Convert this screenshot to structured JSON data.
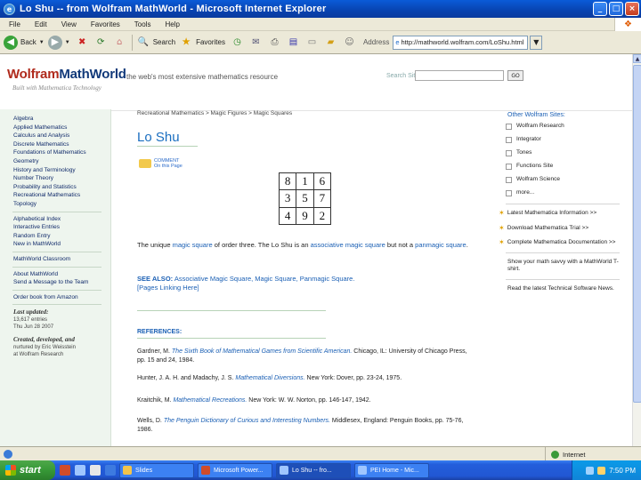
{
  "window": {
    "title": "Lo Shu -- from Wolfram MathWorld - Microsoft Internet Explorer"
  },
  "menu": [
    "File",
    "Edit",
    "View",
    "Favorites",
    "Tools",
    "Help"
  ],
  "toolbar": {
    "back": "Back",
    "search": "Search",
    "favorites": "Favorites",
    "address_label": "Address",
    "address": "http://mathworld.wolfram.com/LoShu.html"
  },
  "header": {
    "logo_wolfram": "Wolfram",
    "logo_mathworld": "MathWorld",
    "tagline": "the web's most extensive mathematics resource",
    "built_with": "Built with Mathematica Technology",
    "search_label": "Search Site",
    "search_go": "GO"
  },
  "left_sidebar": {
    "topics": [
      "Algebra",
      "Applied Mathematics",
      "Calculus and Analysis",
      "Discrete Mathematics",
      "Foundations of Mathematics",
      "Geometry",
      "History and Terminology",
      "Number Theory",
      "Probability and Statistics",
      "Recreational Mathematics",
      "Topology"
    ],
    "links": [
      "Alphabetical Index",
      "Interactive Entries",
      "Random Entry",
      "New in MathWorld"
    ],
    "links2": [
      "MathWorld Classroom"
    ],
    "links3": [
      "About MathWorld",
      "Send a Message to the Team"
    ],
    "links4": [
      "Order book from Amazon"
    ],
    "updated_label": "Last updated:",
    "updated_entries": "13,617 entries",
    "updated_date": "Thu Jun 28 2007",
    "credit_label": "Created, developed, and",
    "credit_2": "nurtured by Eric Weisstein",
    "credit_3": "at Wolfram Research"
  },
  "main": {
    "breadcrumb": "Recreational Mathematics > Magic Figures > Magic Squares",
    "title": "Lo Shu",
    "comment_1": "COMMENT",
    "comment_2": "On this Page",
    "square": [
      [
        "8",
        "1",
        "6"
      ],
      [
        "3",
        "5",
        "7"
      ],
      [
        "4",
        "9",
        "2"
      ]
    ],
    "desc_1": "The unique ",
    "desc_link1": "magic square",
    "desc_2": " of order three. The Lo Shu is an ",
    "desc_link2": "associative magic square",
    "desc_3": " but not a ",
    "desc_link3": "panmagic square",
    "desc_4": ".",
    "see_also_label": "SEE ALSO:",
    "see_also_text": " Associative Magic Square, Magic Square, Panmagic Square.",
    "see_also_pages": "[Pages Linking Here]",
    "refs_title": "REFERENCES:",
    "refs": [
      {
        "pre": "Gardner, M. ",
        "italic": "The Sixth Book of Mathematical Games from Scientific American.",
        "post": " Chicago, IL: University of Chicago Press, pp. 15 and 24, 1984."
      },
      {
        "pre": "Hunter, J. A. H. and Madachy, J. S. ",
        "italic": "Mathematical Diversions.",
        "post": " New York: Dover, pp. 23-24, 1975."
      },
      {
        "pre": "Kraitchik, M. ",
        "italic": "Mathematical Recreations.",
        "post": " New York: W. W. Norton, pp. 146-147, 1942."
      },
      {
        "pre": "Wells, D. ",
        "italic": "The Penguin Dictionary of Curious and Interesting Numbers.",
        "post": " Middlesex, England: Penguin Books, pp. 75-76, 1986."
      }
    ]
  },
  "right_sidebar": {
    "title": "Other Wolfram Sites:",
    "sites": [
      "Wolfram Research",
      "Integrator",
      "Tones",
      "Functions Site",
      "Wolfram Science",
      "more..."
    ],
    "promo_1": "Latest Mathematica Information >>",
    "promo_2": "Download Mathematica Trial >>",
    "promo_3": "Complete Mathematica Documentation >>",
    "promo_4": "Show your math savvy with a MathWorld T-shirt.",
    "promo_5": "Read the latest Technical Software News."
  },
  "status": {
    "zone": "Internet"
  },
  "taskbar": {
    "start": "start",
    "tasks": [
      "Slides",
      "Microsoft Power...",
      "Lo Shu -- fro...",
      "PEI Home - Mic..."
    ],
    "clock": "7:50 PM"
  }
}
